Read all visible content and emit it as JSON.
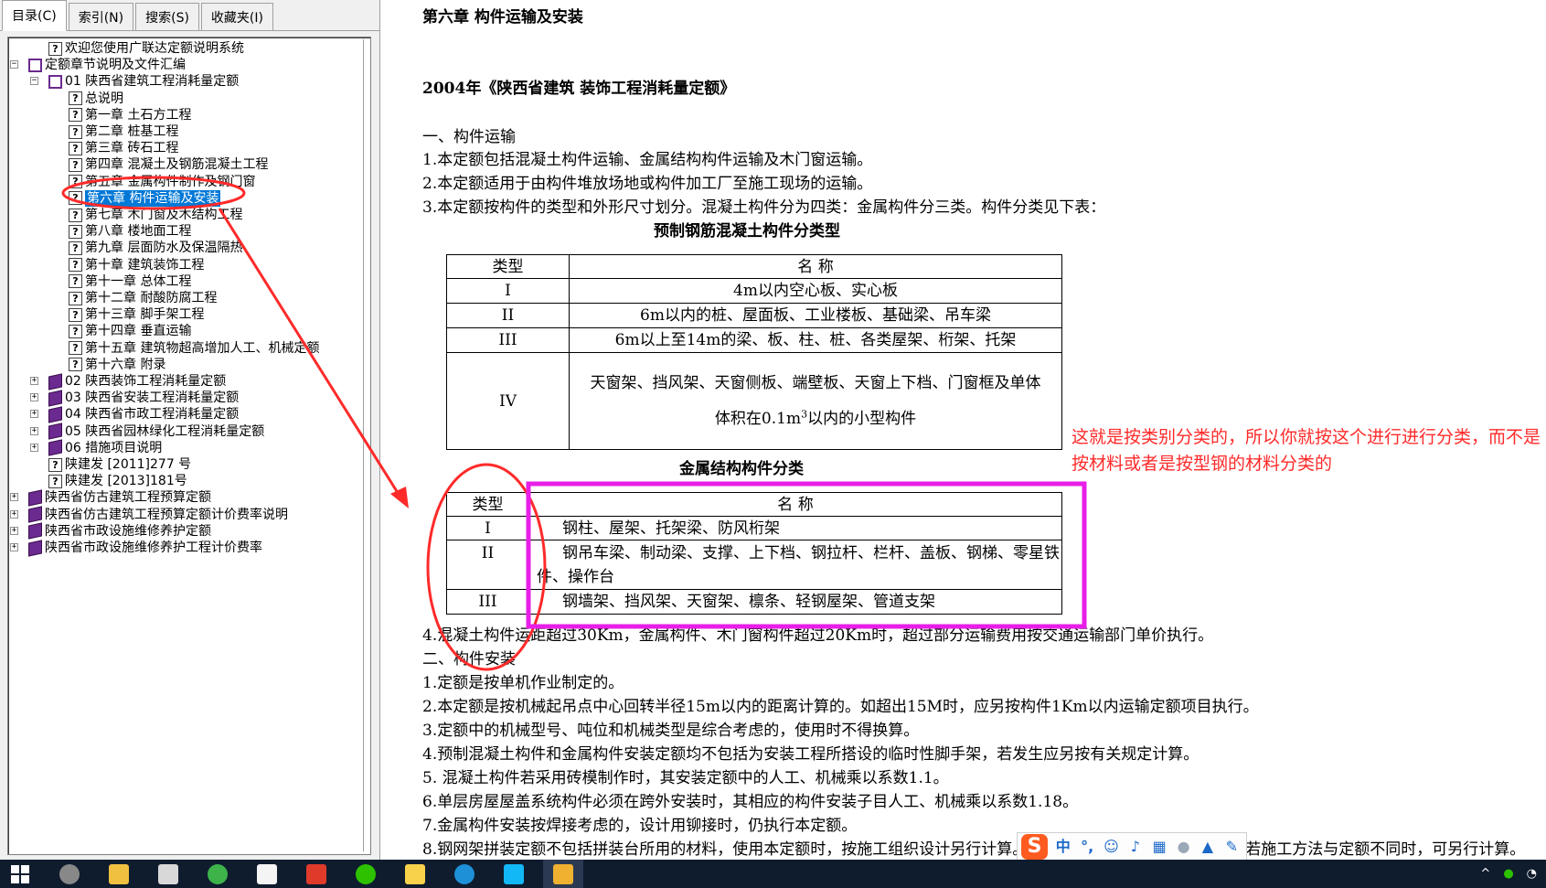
{
  "tabs": [
    {
      "label": "目录(C)",
      "active": true
    },
    {
      "label": "索引(N)",
      "active": false
    },
    {
      "label": "搜索(S)",
      "active": false
    },
    {
      "label": "收藏夹(I)",
      "active": false
    }
  ],
  "tree": [
    {
      "label": "欢迎您使用广联达定额说明系统",
      "icon": "help-page-icon",
      "level": 1,
      "expander": ""
    },
    {
      "label": "定额章节说明及文件汇编",
      "icon": "book-open-icon",
      "level": 0,
      "expander": "−"
    },
    {
      "label": "01 陕西省建筑工程消耗量定额",
      "icon": "book-open-icon",
      "level": 1,
      "expander": "−"
    },
    {
      "label": "总说明",
      "icon": "help-page-icon",
      "level": 2,
      "expander": ""
    },
    {
      "label": "第一章  土石方工程",
      "icon": "help-page-icon",
      "level": 2,
      "expander": ""
    },
    {
      "label": "第二章  桩基工程",
      "icon": "help-page-icon",
      "level": 2,
      "expander": ""
    },
    {
      "label": "第三章  砖石工程",
      "icon": "help-page-icon",
      "level": 2,
      "expander": ""
    },
    {
      "label": "第四章  混凝土及钢筋混凝土工程",
      "icon": "help-page-icon",
      "level": 2,
      "expander": ""
    },
    {
      "label": "第五章  金属构件制作及钢门窗",
      "icon": "help-page-icon",
      "level": 2,
      "expander": ""
    },
    {
      "label": "第六章  构件运输及安装",
      "icon": "help-page-icon",
      "level": 2,
      "expander": "",
      "selected": true
    },
    {
      "label": "第七章  木门窗及木结构工程",
      "icon": "help-page-icon",
      "level": 2,
      "expander": ""
    },
    {
      "label": "第八章  楼地面工程",
      "icon": "help-page-icon",
      "level": 2,
      "expander": ""
    },
    {
      "label": "第九章  层面防水及保温隔热",
      "icon": "help-page-icon",
      "level": 2,
      "expander": ""
    },
    {
      "label": "第十章  建筑装饰工程",
      "icon": "help-page-icon",
      "level": 2,
      "expander": ""
    },
    {
      "label": "第十一章  总体工程",
      "icon": "help-page-icon",
      "level": 2,
      "expander": ""
    },
    {
      "label": "第十二章  耐酸防腐工程",
      "icon": "help-page-icon",
      "level": 2,
      "expander": ""
    },
    {
      "label": "第十三章  脚手架工程",
      "icon": "help-page-icon",
      "level": 2,
      "expander": ""
    },
    {
      "label": "第十四章  垂直运输",
      "icon": "help-page-icon",
      "level": 2,
      "expander": ""
    },
    {
      "label": "第十五章  建筑物超高增加人工、机械定额",
      "icon": "help-page-icon",
      "level": 2,
      "expander": ""
    },
    {
      "label": "第十六章  附录",
      "icon": "help-page-icon",
      "level": 2,
      "expander": ""
    },
    {
      "label": "02 陕西装饰工程消耗量定额",
      "icon": "book-icon",
      "level": 1,
      "expander": "+"
    },
    {
      "label": "03 陕西省安装工程消耗量定额",
      "icon": "book-icon",
      "level": 1,
      "expander": "+"
    },
    {
      "label": "04 陕西省市政工程消耗量定额",
      "icon": "book-icon",
      "level": 1,
      "expander": "+"
    },
    {
      "label": "05 陕西省园林绿化工程消耗量定额",
      "icon": "book-icon",
      "level": 1,
      "expander": "+"
    },
    {
      "label": "06 措施项目说明",
      "icon": "book-icon",
      "level": 1,
      "expander": "+"
    },
    {
      "label": "陕建发 [2011]277 号",
      "icon": "help-page-icon",
      "level": 1,
      "expander": ""
    },
    {
      "label": "陕建发 [2013]181号",
      "icon": "help-page-icon",
      "level": 1,
      "expander": ""
    },
    {
      "label": "陕西省仿古建筑工程预算定额",
      "icon": "book-icon",
      "level": 0,
      "expander": "+"
    },
    {
      "label": "陕西省仿古建筑工程预算定额计价费率说明",
      "icon": "book-icon",
      "level": 0,
      "expander": "+"
    },
    {
      "label": "陕西省市政设施维修养护定额",
      "icon": "book-icon",
      "level": 0,
      "expander": "+"
    },
    {
      "label": "陕西省市政设施维修养护工程计价费率",
      "icon": "book-icon",
      "level": 0,
      "expander": "+"
    }
  ],
  "doc": {
    "chapter_title": "第六章    构件运输及安装",
    "book_title": "2004年《陕西省建筑 装饰工程消耗量定额》",
    "sec1_heading": "一、构件运输",
    "sec1_items": [
      "1.本定额包括混凝土构件运输、金属结构构件运输及木门窗运输。",
      "2.本定额适用于由构件堆放场地或构件加工厂至施工现场的运输。",
      "3.本定额按构件的类型和外形尺寸划分。混凝土构件分为四类：金属构件分三类。构件分类见下表："
    ],
    "table1": {
      "title": "预制钢筋混凝土构件分类型",
      "header": [
        "类型",
        "名        称"
      ],
      "rows": [
        [
          "I",
          "4m以内空心板、实心板"
        ],
        [
          "II",
          "6m以内的桩、屋面板、工业楼板、基础梁、吊车梁"
        ],
        [
          "III",
          "6m以上至14m的梁、板、柱、桩、各类屋架、桁架、托架"
        ]
      ],
      "row4_type": "IV",
      "row4_line1": "天窗架、挡风架、天窗侧板、端壁板、天窗上下档、门窗框及单体",
      "row4_line2_pre": "体积在0.1m",
      "row4_line2_sup": "3",
      "row4_line2_post": "以内的小型构件"
    },
    "table2": {
      "title": "金属结构构件分类",
      "header": [
        "类型",
        "名          称"
      ],
      "rows": [
        [
          "I",
          "钢柱、屋架、托架梁、防风桁架"
        ],
        [
          "II",
          "钢吊车梁、制动梁、支撑、上下档、钢拉杆、栏杆、盖板、钢梯、零星铁件、操作台"
        ],
        [
          "III",
          "钢墙架、挡风架、天窗架、檩条、轻钢屋架、管道支架"
        ]
      ]
    },
    "sec1_item4": "4.混凝土构件运距超过30Km，金属构件、木门窗构件超过20Km时，超过部分运输费用按交通运输部门单价执行。",
    "sec2_heading": "二、构件安装",
    "sec2_items": [
      "1.定额是按单机作业制定的。",
      "2.本定额是按机械起吊点中心回转半径15m以内的距离计算的。如超出15M时，应另按构件1Km以内运输定额项目执行。",
      "3.定额中的机械型号、吨位和机械类型是综合考虑的，使用时不得换算。",
      "4.预制混凝土构件和金属构件安装定额均不包括为安装工程所搭设的临时性脚手架，若发生应另按有关规定计算。",
      "5.  混凝土构件若采用砖模制作时，其安装定额中的人工、机械乘以系数1.1。",
      "6.单层房屋屋盖系统构件必须在跨外安装时，其相应的构件安装子目人工、机械乘以系数1.18。",
      "7.金属构件安装按焊接考虑的，设计用铆接时，仍执行本定额。",
      "8.钢网架拼装定额不包括拼装台所用的材料，使用本定额时，按施工组织设计另行计算。网架安装是按分体吊装考虑的，若施工方法与定额不同时，可另行计算。"
    ]
  },
  "annotation": {
    "note": "这就是按类别分类的，所以你就按这个进行进行分类，而不是按材料或者是按型钢的材料分类的",
    "colors": {
      "red": "#ff2a2a",
      "magenta": "#e81ee8"
    }
  },
  "ime": {
    "logo": "S",
    "mode": "中",
    "punct": "°,"
  },
  "taskbar": {
    "items": [
      "windows-start-icon",
      "media-icon",
      "folder-icon",
      "store-icon",
      "browser-icon",
      "mail-icon",
      "pdf-icon",
      "wechat-icon",
      "notes-icon",
      "edge-icon",
      "qq-icon",
      "help-app-icon"
    ],
    "tray_text": ""
  }
}
